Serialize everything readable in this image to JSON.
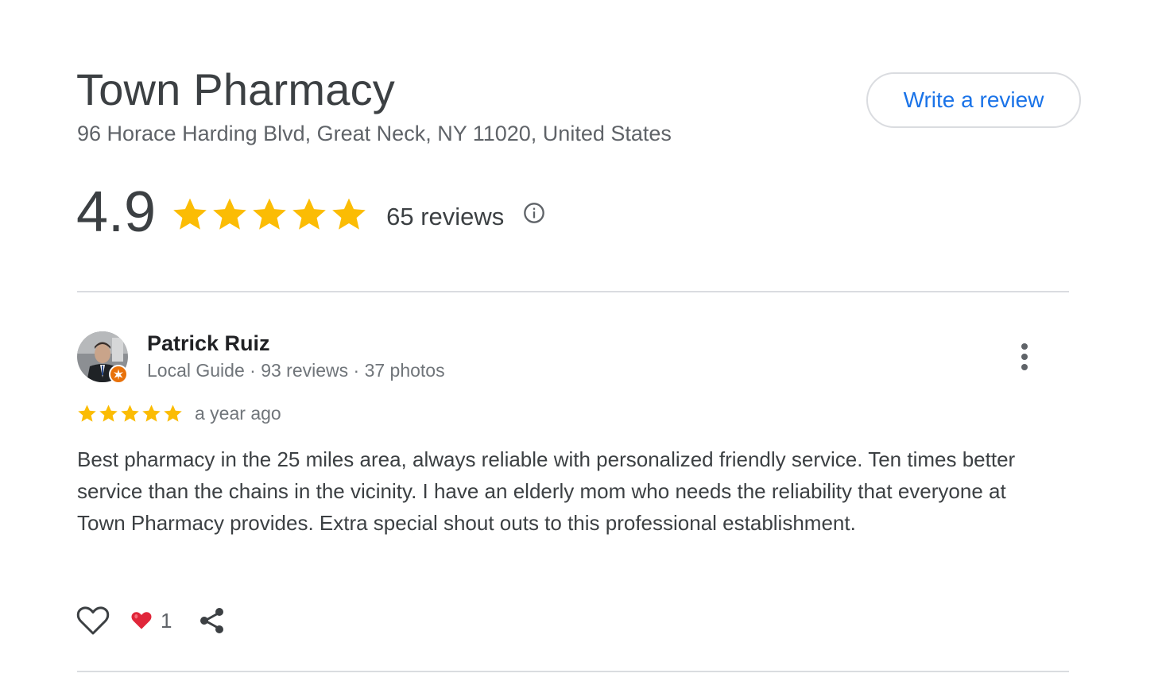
{
  "place": {
    "title": "Town Pharmacy",
    "address": "96 Horace Harding Blvd, Great Neck, NY 11020, United States",
    "write_review_label": "Write a review",
    "rating": "4.9",
    "rating_stars": 5,
    "review_count_label": "65 reviews"
  },
  "review": {
    "reviewer_name": "Patrick Ruiz",
    "reviewer_meta": "Local Guide · 93 reviews · 37 photos",
    "rating_stars": 5,
    "date": "a year ago",
    "text": "Best pharmacy in the 25 miles area, always reliable with personalized friendly service. Ten times better service than the chains in the vicinity. I have an elderly mom who needs the reliability that everyone at Town Pharmacy provides. Extra special shout outs to this professional establishment.",
    "reaction_count": "1"
  },
  "icons": {
    "star": "star-icon",
    "info": "info-icon",
    "more": "more-vert-icon",
    "like": "heart-outline-icon",
    "reaction": "red-heart-icon",
    "share": "share-icon",
    "badge": "local-guide-badge-icon"
  },
  "colors": {
    "star": "#fbbc04",
    "link": "#1a73e8",
    "divider": "#dadce0",
    "badge": "#e8710a",
    "heart": "#e0263a"
  }
}
